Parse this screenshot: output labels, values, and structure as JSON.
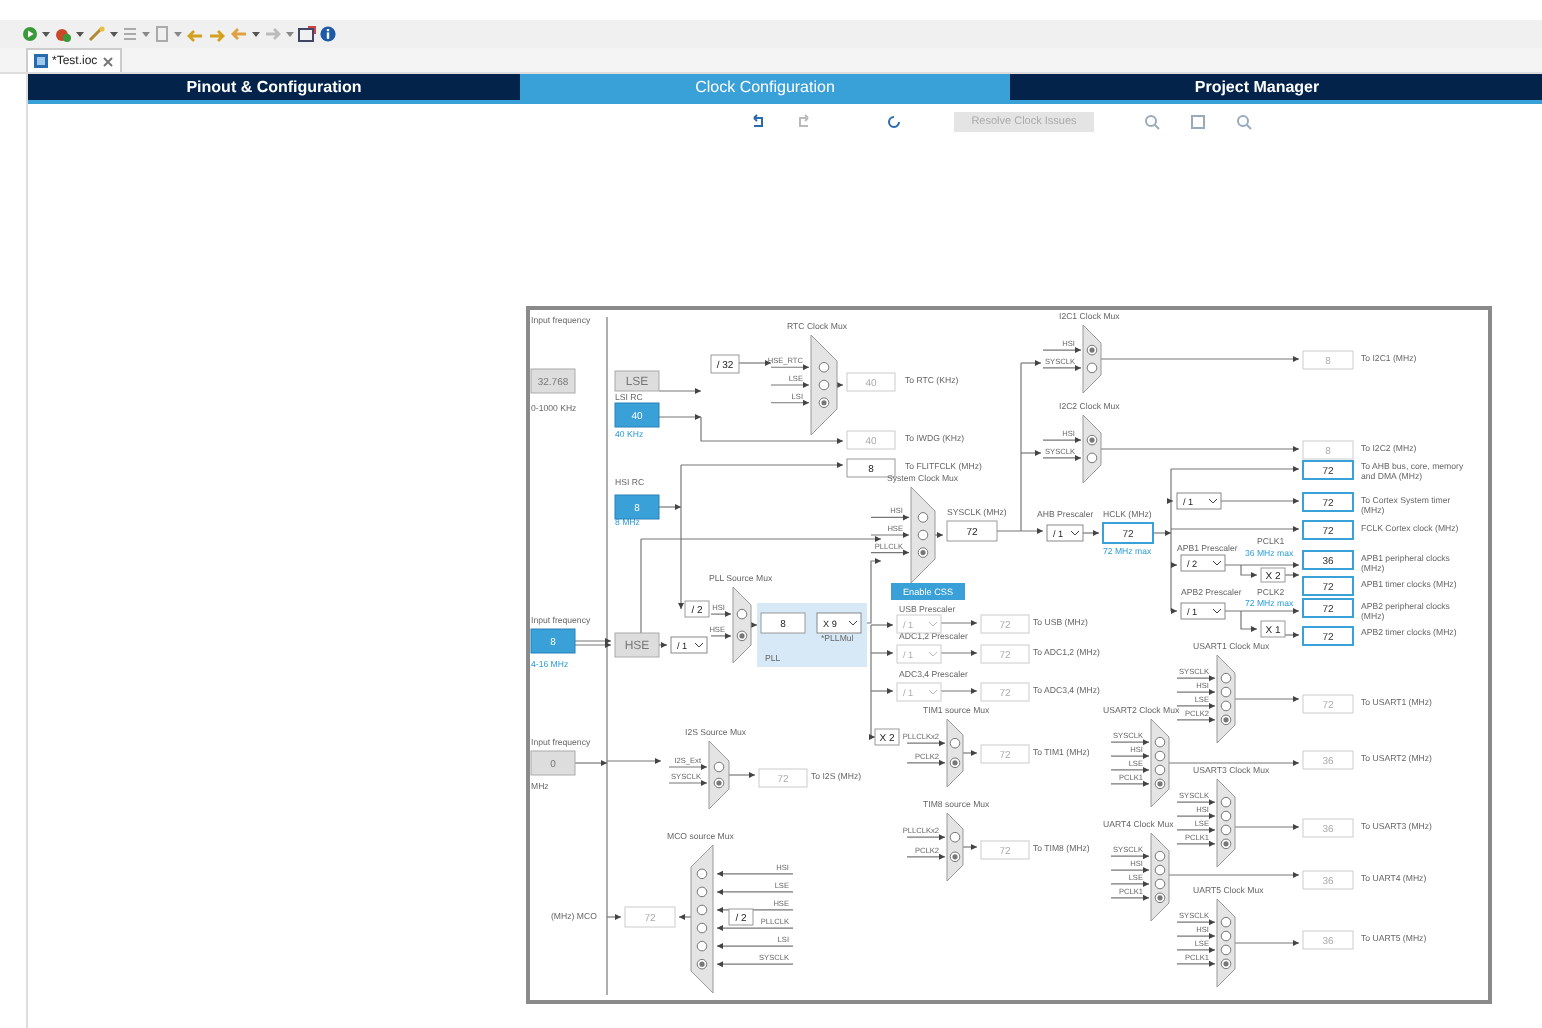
{
  "file_tab": {
    "label": "*Test.ioc"
  },
  "tabs": [
    {
      "label": "Pinout & Configuration",
      "selected": false
    },
    {
      "label": "Clock Configuration",
      "selected": true
    },
    {
      "label": "Project Manager",
      "selected": false
    }
  ],
  "resolve_button": {
    "label": "Resolve Clock Issues",
    "disabled": true
  },
  "diagram": {
    "texts": [
      {
        "text": "Input frequency",
        "kind": "label"
      },
      {
        "text": "0-1000 KHz",
        "kind": "label"
      },
      {
        "text": "LSI RC",
        "kind": "label"
      },
      {
        "text": "40 KHz",
        "kind": "hint"
      },
      {
        "text": "HSI RC",
        "kind": "label"
      },
      {
        "text": "8 MHz",
        "kind": "hint"
      },
      {
        "text": "Input frequency",
        "kind": "label"
      },
      {
        "text": "4-16 MHz",
        "kind": "hint"
      },
      {
        "text": "Input frequency",
        "kind": "label"
      },
      {
        "text": "MHz",
        "kind": "label"
      },
      {
        "text": "To RTC (KHz)",
        "kind": "label"
      },
      {
        "text": "To IWDG (KHz)",
        "kind": "label"
      },
      {
        "text": "To FLITFCLK (MHz)",
        "kind": "label"
      },
      {
        "text": "SYSCLK (MHz)",
        "kind": "label"
      },
      {
        "text": "PLL",
        "kind": "label"
      },
      {
        "text": "*PLLMul",
        "kind": "label"
      },
      {
        "text": "USB Prescaler",
        "kind": "label"
      },
      {
        "text": "To USB (MHz)",
        "kind": "label"
      },
      {
        "text": "ADC1,2 Prescaler",
        "kind": "label"
      },
      {
        "text": "To ADC1,2 (MHz)",
        "kind": "label"
      },
      {
        "text": "ADC3,4 Prescaler",
        "kind": "label"
      },
      {
        "text": "To ADC3,4 (MHz)",
        "kind": "label"
      },
      {
        "text": "To TIM1 (MHz)",
        "kind": "label"
      },
      {
        "text": "To TIM8 (MHz)",
        "kind": "label"
      },
      {
        "text": "To I2S (MHz)",
        "kind": "label"
      },
      {
        "text": "(MHz) MCO",
        "kind": "label"
      },
      {
        "text": "To I2C1 (MHz)",
        "kind": "label"
      },
      {
        "text": "To I2C2 (MHz)",
        "kind": "label"
      },
      {
        "text": "AHB Prescaler",
        "kind": "label"
      },
      {
        "text": "HCLK (MHz)",
        "kind": "label"
      },
      {
        "text": "72 MHz max",
        "kind": "hint"
      },
      {
        "text": "To AHB bus, core, memory and DMA (MHz)",
        "kind": "label"
      },
      {
        "text": "To Cortex System timer (MHz)",
        "kind": "label"
      },
      {
        "text": "FCLK Cortex clock (MHz)",
        "kind": "label"
      },
      {
        "text": "APB1 Prescaler",
        "kind": "label"
      },
      {
        "text": "PCLK1",
        "kind": "label"
      },
      {
        "text": "36 MHz max",
        "kind": "hint"
      },
      {
        "text": "APB1 peripheral clocks (MHz)",
        "kind": "label"
      },
      {
        "text": "APB1 timer clocks (MHz)",
        "kind": "label"
      },
      {
        "text": "APB2 Prescaler",
        "kind": "label"
      },
      {
        "text": "PCLK2",
        "kind": "label"
      },
      {
        "text": "72 MHz max",
        "kind": "hint"
      },
      {
        "text": "APB2 peripheral clocks (MHz)",
        "kind": "label"
      },
      {
        "text": "APB2 timer clocks (MHz)",
        "kind": "label"
      },
      {
        "text": "To USART1 (MHz)",
        "kind": "label"
      },
      {
        "text": "To USART2 (MHz)",
        "kind": "label"
      },
      {
        "text": "To USART3 (MHz)",
        "kind": "label"
      },
      {
        "text": "To UART4 (MHz)",
        "kind": "label"
      },
      {
        "text": "To UART5 (MHz)",
        "kind": "label"
      }
    ],
    "boxes": [
      {
        "value": "32.768",
        "kind": "input"
      },
      {
        "value": "LSE",
        "kind": "block"
      },
      {
        "value": "40",
        "kind": "source"
      },
      {
        "value": "8",
        "kind": "source"
      },
      {
        "value": "8",
        "kind": "source"
      },
      {
        "value": "HSE",
        "kind": "block"
      },
      {
        "value": "0",
        "kind": "input"
      },
      {
        "value": "/ 32",
        "kind": "factor"
      },
      {
        "value": "40",
        "kind": "output"
      },
      {
        "value": "40",
        "kind": "output"
      },
      {
        "value": "8",
        "kind": "value"
      },
      {
        "value": "72",
        "kind": "value"
      },
      {
        "value": "/ 2",
        "kind": "factor"
      },
      {
        "value": "8",
        "kind": "value"
      },
      {
        "value": "72",
        "kind": "output"
      },
      {
        "value": "72",
        "kind": "output"
      },
      {
        "value": "72",
        "kind": "output"
      },
      {
        "value": "X 2",
        "kind": "factor"
      },
      {
        "value": "72",
        "kind": "output"
      },
      {
        "value": "72",
        "kind": "output"
      },
      {
        "value": "72",
        "kind": "output"
      },
      {
        "value": "/ 2",
        "kind": "factor"
      },
      {
        "value": "72",
        "kind": "output"
      },
      {
        "value": "8",
        "kind": "output"
      },
      {
        "value": "8",
        "kind": "output"
      },
      {
        "value": "72",
        "kind": "active"
      },
      {
        "value": "72",
        "kind": "active"
      },
      {
        "value": "72",
        "kind": "active"
      },
      {
        "value": "72",
        "kind": "active"
      },
      {
        "value": "36",
        "kind": "active"
      },
      {
        "value": "X 2",
        "kind": "factor"
      },
      {
        "value": "72",
        "kind": "active"
      },
      {
        "value": "72",
        "kind": "active"
      },
      {
        "value": "X 1",
        "kind": "factor"
      },
      {
        "value": "72",
        "kind": "active"
      },
      {
        "value": "72",
        "kind": "output"
      },
      {
        "value": "36",
        "kind": "output"
      },
      {
        "value": "36",
        "kind": "output"
      },
      {
        "value": "36",
        "kind": "output"
      },
      {
        "value": "36",
        "kind": "output"
      }
    ],
    "dropdowns": [
      {
        "value": "/ 1",
        "disabled": false
      },
      {
        "value": "X 9",
        "disabled": false
      },
      {
        "value": "/ 1",
        "disabled": true
      },
      {
        "value": "/ 1",
        "disabled": true
      },
      {
        "value": "/ 1",
        "disabled": true
      },
      {
        "value": "/ 1",
        "disabled": false
      },
      {
        "value": "/ 1",
        "disabled": false
      },
      {
        "value": "/ 2",
        "disabled": false
      },
      {
        "value": "/ 1",
        "disabled": false
      }
    ],
    "css_button": {
      "label": "Enable CSS"
    },
    "muxes": [
      {
        "title": "RTC Clock Mux",
        "inputs": [
          {
            "label": "HSE_RTC",
            "selected": false
          },
          {
            "label": "LSE",
            "selected": false
          },
          {
            "label": "LSI",
            "selected": true
          }
        ]
      },
      {
        "title": "System Clock Mux",
        "inputs": [
          {
            "label": "HSI",
            "selected": false
          },
          {
            "label": "HSE",
            "selected": false
          },
          {
            "label": "PLLCLK",
            "selected": true
          }
        ]
      },
      {
        "title": "PLL Source Mux",
        "inputs": [
          {
            "label": "HSI",
            "selected": false
          },
          {
            "label": "HSE",
            "selected": true
          }
        ]
      },
      {
        "title": "I2C1 Clock Mux",
        "inputs": [
          {
            "label": "HSI",
            "selected": true
          },
          {
            "label": "SYSCLK",
            "selected": false
          }
        ]
      },
      {
        "title": "I2C2 Clock Mux",
        "inputs": [
          {
            "label": "HSI",
            "selected": true
          },
          {
            "label": "SYSCLK",
            "selected": false
          }
        ]
      },
      {
        "title": "TIM1 source Mux",
        "inputs": [
          {
            "label": "PLLCLKx2",
            "selected": false
          },
          {
            "label": "PCLK2",
            "selected": true
          }
        ]
      },
      {
        "title": "TIM8 source Mux",
        "inputs": [
          {
            "label": "PLLCLKx2",
            "selected": false
          },
          {
            "label": "PCLK2",
            "selected": true
          }
        ]
      },
      {
        "title": "I2S Source Mux",
        "inputs": [
          {
            "label": "I2S_Ext",
            "selected": false
          },
          {
            "label": "SYSCLK",
            "selected": true
          }
        ]
      },
      {
        "title": "MCO source Mux",
        "inputs": [
          {
            "label": "HSI",
            "selected": false
          },
          {
            "label": "LSE",
            "selected": false
          },
          {
            "label": "HSE",
            "selected": false
          },
          {
            "label": "PLLCLK",
            "selected": false
          },
          {
            "label": "LSI",
            "selected": false
          },
          {
            "label": "SYSCLK",
            "selected": true
          }
        ]
      },
      {
        "title": "USART1 Clock Mux",
        "inputs": [
          {
            "label": "SYSCLK",
            "selected": false
          },
          {
            "label": "HSI",
            "selected": false
          },
          {
            "label": "LSE",
            "selected": false
          },
          {
            "label": "PCLK2",
            "selected": true
          }
        ]
      },
      {
        "title": "USART2 Clock Mux",
        "inputs": [
          {
            "label": "SYSCLK",
            "selected": false
          },
          {
            "label": "HSI",
            "selected": false
          },
          {
            "label": "LSE",
            "selected": false
          },
          {
            "label": "PCLK1",
            "selected": true
          }
        ]
      },
      {
        "title": "USART3 Clock Mux",
        "inputs": [
          {
            "label": "SYSCLK",
            "selected": false
          },
          {
            "label": "HSI",
            "selected": false
          },
          {
            "label": "LSE",
            "selected": false
          },
          {
            "label": "PCLK1",
            "selected": true
          }
        ]
      },
      {
        "title": "UART4 Clock Mux",
        "inputs": [
          {
            "label": "SYSCLK",
            "selected": false
          },
          {
            "label": "HSI",
            "selected": false
          },
          {
            "label": "LSE",
            "selected": false
          },
          {
            "label": "PCLK1",
            "selected": true
          }
        ]
      },
      {
        "title": "UART5 Clock Mux",
        "inputs": [
          {
            "label": "SYSCLK",
            "selected": false
          },
          {
            "label": "HSI",
            "selected": false
          },
          {
            "label": "LSE",
            "selected": false
          },
          {
            "label": "PCLK1",
            "selected": true
          }
        ]
      }
    ]
  }
}
